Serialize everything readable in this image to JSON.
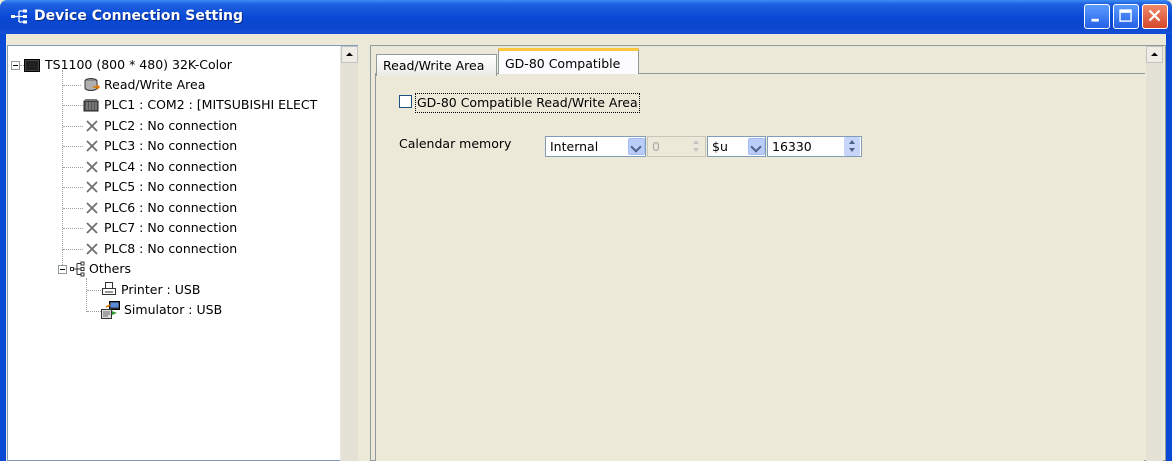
{
  "window": {
    "title": "Device Connection Setting"
  },
  "tree": {
    "root": "TS1100 (800 * 480) 32K-Color",
    "items": [
      {
        "label": "Read/Write Area",
        "icon": "database-icon"
      },
      {
        "label": "PLC1 : COM2 : [MITSUBISHI ELECT",
        "icon": "plc-icon"
      },
      {
        "label": "PLC2 : No connection",
        "icon": "x-icon"
      },
      {
        "label": "PLC3 : No connection",
        "icon": "x-icon"
      },
      {
        "label": "PLC4 : No connection",
        "icon": "x-icon"
      },
      {
        "label": "PLC5 : No connection",
        "icon": "x-icon"
      },
      {
        "label": "PLC6 : No connection",
        "icon": "x-icon"
      },
      {
        "label": "PLC7 : No connection",
        "icon": "x-icon"
      },
      {
        "label": "PLC8 : No connection",
        "icon": "x-icon"
      }
    ],
    "others": {
      "label": "Others",
      "children": [
        {
          "label": "Printer : USB",
          "icon": "printer-icon"
        },
        {
          "label": "Simulator : USB",
          "icon": "simulator-icon"
        }
      ]
    }
  },
  "tabs": [
    {
      "label": "Read/Write Area",
      "active": false
    },
    {
      "label": "GD-80 Compatible",
      "active": true
    }
  ],
  "panel": {
    "compat_checkbox_label": "GD-80 Compatible Read/Write Area",
    "compat_checked": false,
    "calendar_label": "Calendar memory",
    "memory_type": "Internal",
    "station_number": "0",
    "device": "$u",
    "address": "16330"
  },
  "colors": {
    "titlebar": "#0a49d6",
    "dialog_bg": "#ece9d8",
    "tab_highlight": "#ffc83c"
  }
}
